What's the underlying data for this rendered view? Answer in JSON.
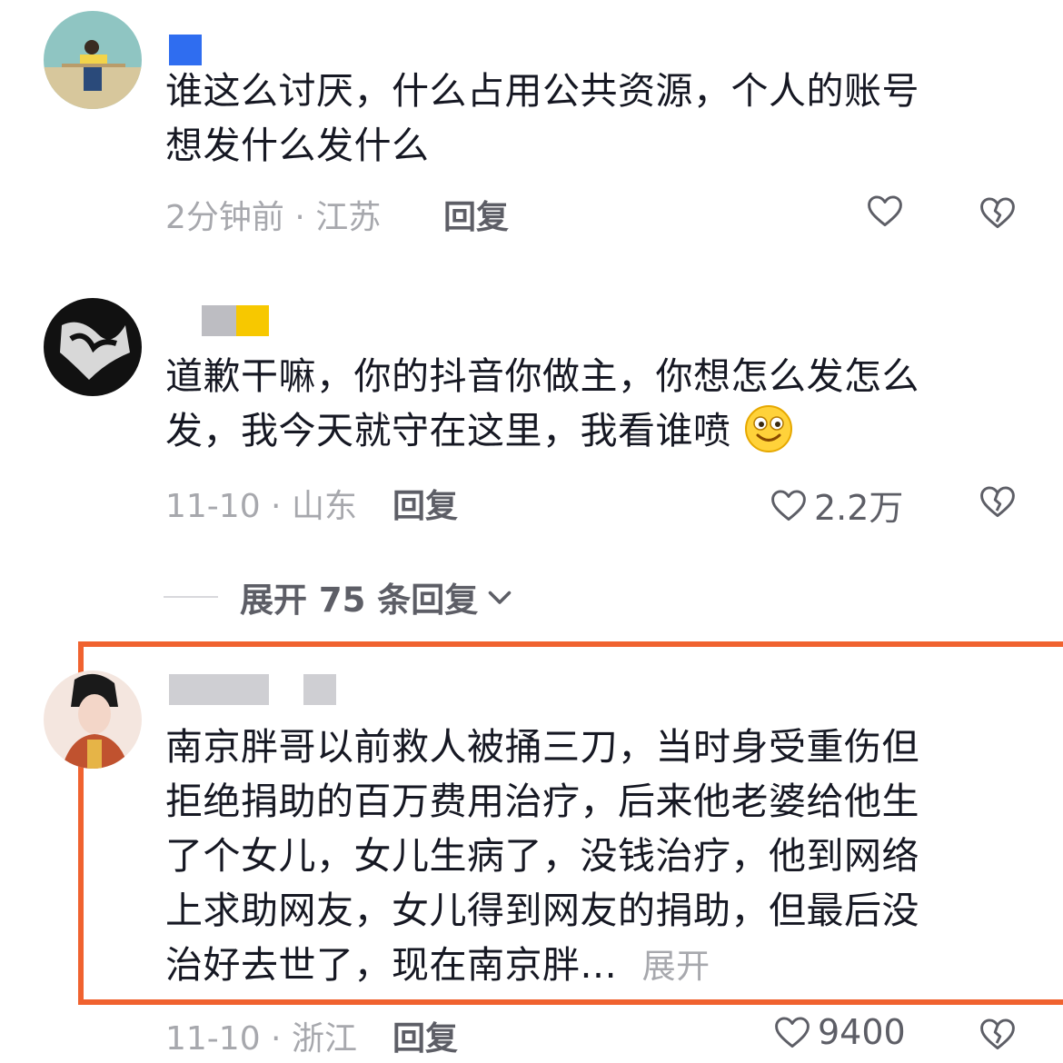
{
  "comments": [
    {
      "text_lines": [
        "谁这么讨厌，什么占用公共资源，个人的账号",
        "想发什么发什么"
      ],
      "time_location": "2分钟前 · 江苏",
      "reply_label": "回复",
      "like_count": ""
    },
    {
      "text_lines": [
        "道歉干嘛，你的抖音你做主，你想怎么发怎么",
        "发，我今天就守在这里，我看谁喷"
      ],
      "time_location": "11-10 · 山东",
      "reply_label": "回复",
      "like_count": "2.2万"
    },
    {
      "text_lines": [
        "南京胖哥以前救人被捅三刀，当时身受重伤但",
        "拒绝捐助的百万费用治疗，后来他老婆给他生",
        "了个女儿，女儿生病了，没钱治疗，他到网络",
        "上求助网友，女儿得到网友的捐助，但最后没",
        "治好去世了，现在南京胖..."
      ],
      "expand_label": "展开",
      "time_location": "11-10 · 浙江",
      "reply_label": "回复",
      "like_count": "9400"
    }
  ],
  "expand_replies": "展开 75 条回复",
  "colors": {
    "highlight": "#f0622f",
    "meta": "#a7a8ad",
    "text": "#161823"
  },
  "icons": [
    "heart-icon",
    "broken-heart-icon",
    "chevron-down-icon",
    "smile-emoji-icon"
  ]
}
